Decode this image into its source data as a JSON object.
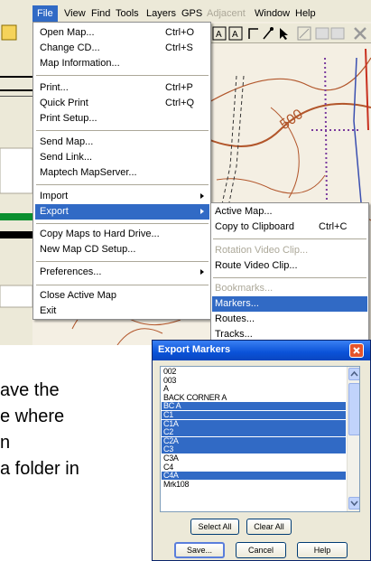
{
  "menubar": {
    "items": [
      "File",
      "View",
      "Find",
      "Tools",
      "Layers",
      "GPS",
      "Adjacent",
      "Window",
      "Help"
    ]
  },
  "file_menu": {
    "open_map": {
      "label": "Open Map...",
      "shortcut": "Ctrl+O"
    },
    "change_cd": {
      "label": "Change CD...",
      "shortcut": "Ctrl+S"
    },
    "map_information": {
      "label": "Map Information..."
    },
    "print": {
      "label": "Print...",
      "shortcut": "Ctrl+P"
    },
    "quick_print": {
      "label": "Quick Print",
      "shortcut": "Ctrl+Q"
    },
    "print_setup": {
      "label": "Print Setup..."
    },
    "send_map": {
      "label": "Send Map..."
    },
    "send_link": {
      "label": "Send Link..."
    },
    "maptech_mapserver": {
      "label": "Maptech MapServer..."
    },
    "import": {
      "label": "Import"
    },
    "export": {
      "label": "Export"
    },
    "copy_maps": {
      "label": "Copy Maps to Hard Drive..."
    },
    "new_map_cd": {
      "label": "New Map CD Setup..."
    },
    "preferences": {
      "label": "Preferences..."
    },
    "close_active_map": {
      "label": "Close Active Map"
    },
    "exit": {
      "label": "Exit"
    }
  },
  "export_menu": {
    "active_map": {
      "label": "Active Map..."
    },
    "copy_to_clipboard": {
      "label": "Copy to Clipboard",
      "shortcut": "Ctrl+C"
    },
    "rotation_video_clip": {
      "label": "Rotation Video Clip..."
    },
    "route_video_clip": {
      "label": "Route Video Clip..."
    },
    "bookmarks": {
      "label": "Bookmarks..."
    },
    "markers": {
      "label": "Markers..."
    },
    "routes": {
      "label": "Routes..."
    },
    "tracks": {
      "label": "Tracks..."
    }
  },
  "map": {
    "contour_label": "500"
  },
  "body_text": {
    "lines": [
      "ave the",
      "e where",
      "n",
      "a folder in"
    ]
  },
  "export_dialog": {
    "title": "Export Markers",
    "items": [
      {
        "label": "002",
        "selected": false
      },
      {
        "label": "003",
        "selected": false
      },
      {
        "label": "A",
        "selected": false
      },
      {
        "label": "BACK CORNER A",
        "selected": false
      },
      {
        "label": "BC A",
        "selected": true
      },
      {
        "label": "C1",
        "selected": true
      },
      {
        "label": "C1A",
        "selected": true
      },
      {
        "label": "C2",
        "selected": true
      },
      {
        "label": "C2A",
        "selected": true
      },
      {
        "label": "C3",
        "selected": true
      },
      {
        "label": "C3A",
        "selected": false
      },
      {
        "label": "C4",
        "selected": false
      },
      {
        "label": "C4A",
        "selected": true
      },
      {
        "label": "Mrk108",
        "selected": false
      }
    ],
    "select_all_label": "Select All",
    "clear_all_label": "Clear All",
    "save_label": "Save...",
    "cancel_label": "Cancel",
    "help_label": "Help"
  },
  "colors": {
    "highlight": "#316ac5",
    "title_bar": "#0a52d8",
    "menu_bg": "#ece9d8",
    "contour": "#b2562b",
    "trail": "#7a3b9e"
  },
  "icons": [
    "open-icon",
    "text-tool-icon",
    "zoom-icon",
    "line-tool-icon",
    "route-tool-icon",
    "pointer-icon",
    "measure-icon",
    "close-icon",
    "scroll-up-icon",
    "scroll-down-icon"
  ]
}
